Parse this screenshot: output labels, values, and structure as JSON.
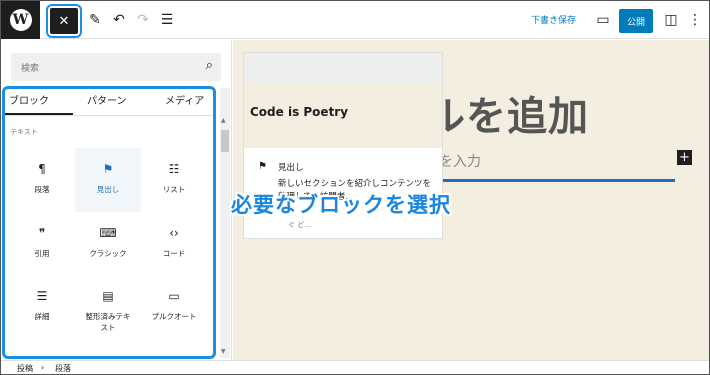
{
  "toolbar": {
    "wp_logo": "W",
    "close_icon": "✕",
    "edit_icon": "✎",
    "undo_icon": "↶",
    "redo_icon": "↷",
    "list_view_icon": "☰",
    "draft_label": "下書き保存",
    "preview_icon": "▭",
    "publish_label": "公開",
    "settings_icon": "◫",
    "more_icon": "⋮"
  },
  "inserter": {
    "search_placeholder": "検索",
    "search_icon": "⌕",
    "tabs": [
      {
        "label": "ブロック",
        "active": true
      },
      {
        "label": "パターン",
        "active": false
      },
      {
        "label": "メディア",
        "active": false
      }
    ],
    "category": "テキスト",
    "blocks": [
      {
        "icon": "¶",
        "label": "段落",
        "active": false
      },
      {
        "icon": "⚑",
        "label": "見出し",
        "active": true
      },
      {
        "icon": "☷",
        "label": "リスト",
        "active": false
      },
      {
        "icon": "❞",
        "label": "引用",
        "active": false
      },
      {
        "icon": "⌨",
        "label": "クラシック",
        "active": false
      },
      {
        "icon": "‹›",
        "label": "コード",
        "active": false
      },
      {
        "icon": "☰",
        "label": "詳細",
        "active": false
      },
      {
        "icon": "▤",
        "label": "整形済みテキスト",
        "active": false
      },
      {
        "icon": "▭",
        "label": "プルクオート",
        "active": false
      }
    ]
  },
  "canvas": {
    "title": "ルを追加",
    "subtitle": "」を入力",
    "plus_icon": "+"
  },
  "preview": {
    "poetry": "Code is Poetry",
    "heading_icon": "⚑",
    "heading_label": "見出し",
    "description": "新しいセクションを紹介しコンテンツを整理して、訪問者…",
    "desc_cut": "ぐ ど…"
  },
  "annotation": {
    "text": "必要なブロックを選択"
  },
  "footer": {
    "crumb1": "投稿",
    "separator": "›",
    "crumb2": "段落"
  },
  "colors": {
    "accent": "#1d8fe1",
    "wp_blue": "#007cba",
    "canvas_bg": "#f3eee0"
  }
}
